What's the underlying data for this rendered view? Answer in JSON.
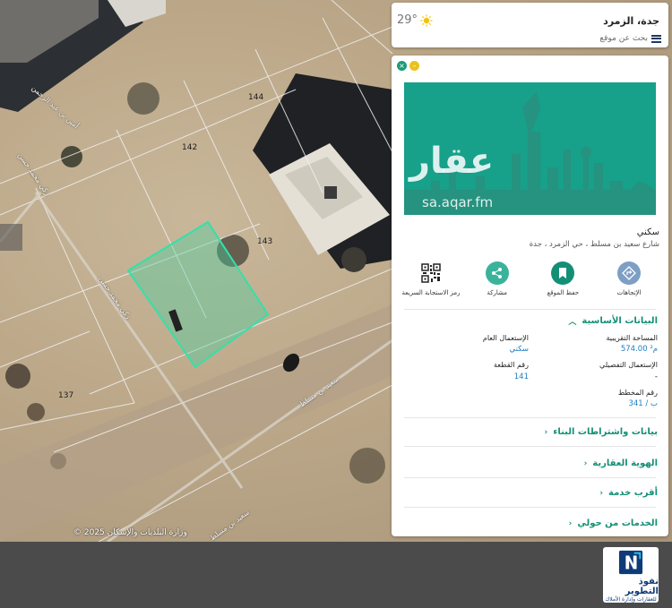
{
  "map": {
    "parcels": [
      "144",
      "142",
      "143",
      "137"
    ],
    "streets": [
      "أمين بن عبد الرحمن",
      "زكي محمد حسن",
      "زكي محمد حسن",
      "سعيد بن مسلط",
      "سعيد بن مسلط"
    ],
    "copyright": "© 2025 وزارة البلديات والإسكان"
  },
  "top_card": {
    "title": "جدة، الزمرد",
    "search_label": "بحث عن موقع",
    "temperature": "29°",
    "weather_icon": "sun-icon",
    "menu_icon": "menu-icon"
  },
  "panel": {
    "banner": {
      "brand": "عقار",
      "url": "sa.aqar.fm",
      "color": "#17a08a"
    },
    "property_type": "سكني",
    "address": "شارع سعيد بن مسلط ، حي الزمرد ، جدة",
    "actions": [
      {
        "label": "الإتجاهات",
        "icon": "directions-icon",
        "color": "#7e9fc4"
      },
      {
        "label": "حفظ الموقع",
        "icon": "bookmark-icon",
        "color": "#148f76"
      },
      {
        "label": "مشاركة",
        "icon": "share-icon",
        "color": "#3bb39b"
      },
      {
        "label": "رمز الاستجابة السريعة",
        "icon": "qr-code-icon",
        "color": "#222222"
      }
    ],
    "basic_data": {
      "title": "البيانات الأساسية",
      "area_label": "المساحة التقريبية",
      "area_value": "574.00 م²",
      "general_use_label": "الإستعمال العام",
      "general_use_value": "سكني",
      "detailed_use_label": "الإستعمال التفصيلي",
      "detailed_use_value": "-",
      "plot_number_label": "رقم القطعة",
      "plot_number_value": "141",
      "plan_number_label": "رقم المخطط",
      "plan_number_value": "ب / 341"
    },
    "sections": [
      {
        "title": "بيانات واشتراطات البناء"
      },
      {
        "title": "الهوية العقارية"
      },
      {
        "title": "أقرب خدمة"
      },
      {
        "title": "الخدمات من حولي"
      }
    ]
  },
  "brand": {
    "name": "نفوذ التطوير",
    "subtitle": "للعقارات وإدارة الأملاك",
    "color": "#0e3a78"
  }
}
